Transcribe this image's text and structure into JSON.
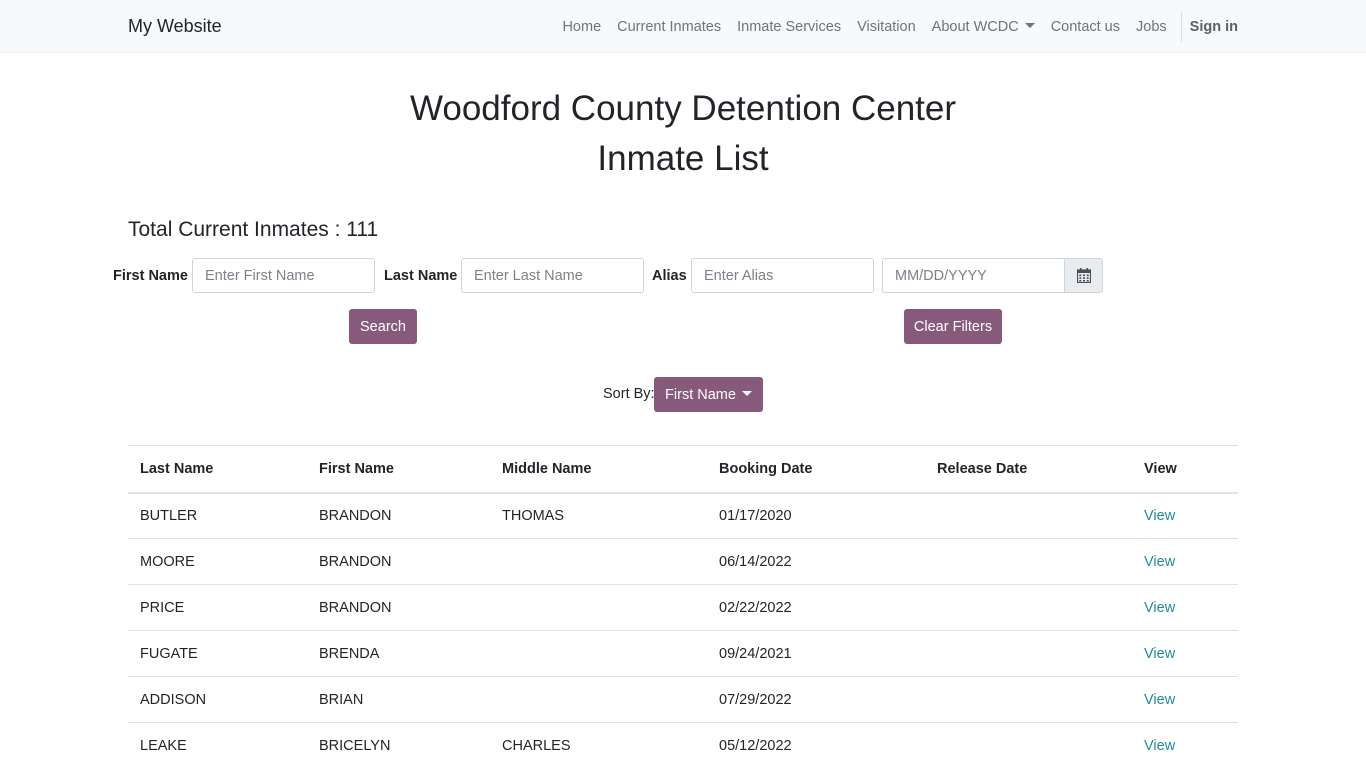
{
  "navbar": {
    "brand": "My Website",
    "items": [
      {
        "label": "Home"
      },
      {
        "label": "Current Inmates"
      },
      {
        "label": "Inmate Services"
      },
      {
        "label": "Visitation"
      },
      {
        "label": "About WCDC"
      },
      {
        "label": "Contact us"
      },
      {
        "label": "Jobs"
      }
    ],
    "signin": "Sign in"
  },
  "page": {
    "title_line1": "Woodford County Detention Center",
    "title_line2": "Inmate List",
    "total": "Total Current Inmates : 111"
  },
  "filters": {
    "first_name_label": "First Name",
    "first_name_placeholder": "Enter First Name",
    "last_name_label": "Last Name",
    "last_name_placeholder": "Enter Last Name",
    "alias_label": "Alias",
    "alias_placeholder": "Enter Alias",
    "date_placeholder": "MM/DD/YYYY",
    "search_label": "Search",
    "clear_label": "Clear Filters"
  },
  "sort": {
    "label": "Sort By:",
    "selected": "First Name"
  },
  "table": {
    "headers": [
      "Last Name",
      "First Name",
      "Middle Name",
      "Booking Date",
      "Release Date",
      "View"
    ],
    "rows": [
      {
        "last": "BUTLER",
        "first": "BRANDON",
        "middle": "THOMAS",
        "booking": "01/17/2020",
        "release": "",
        "view": "View"
      },
      {
        "last": "MOORE",
        "first": "BRANDON",
        "middle": "",
        "booking": "06/14/2022",
        "release": "",
        "view": "View"
      },
      {
        "last": "PRICE",
        "first": "BRANDON",
        "middle": "",
        "booking": "02/22/2022",
        "release": "",
        "view": "View"
      },
      {
        "last": "FUGATE",
        "first": "BRENDA",
        "middle": "",
        "booking": "09/24/2021",
        "release": "",
        "view": "View"
      },
      {
        "last": "ADDISON",
        "first": "BRIAN",
        "middle": "",
        "booking": "07/29/2022",
        "release": "",
        "view": "View"
      },
      {
        "last": "LEAKE",
        "first": "BRICELYN",
        "middle": "CHARLES",
        "booking": "05/12/2022",
        "release": "",
        "view": "View"
      }
    ]
  },
  "colors": {
    "primary": "#875a7b",
    "link": "#1f8a9c",
    "navbar_bg": "#f8f9fa"
  },
  "icons": {
    "calendar": "calendar-icon"
  }
}
